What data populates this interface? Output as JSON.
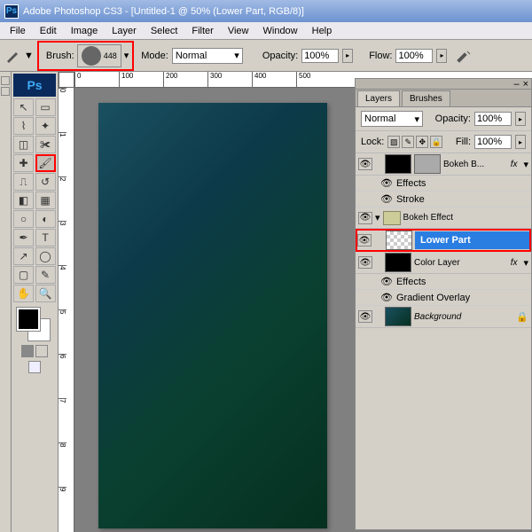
{
  "title": "Adobe Photoshop CS3 - [Untitled-1 @ 50% (Lower Part, RGB/8)]",
  "menu": [
    "File",
    "Edit",
    "Image",
    "Layer",
    "Select",
    "Filter",
    "View",
    "Window",
    "Help"
  ],
  "options": {
    "brush_label": "Brush:",
    "brush_size": "448",
    "mode_label": "Mode:",
    "mode_value": "Normal",
    "opacity_label": "Opacity:",
    "opacity_value": "100%",
    "flow_label": "Flow:",
    "flow_value": "100%"
  },
  "layers_panel": {
    "tabs": [
      "Layers",
      "Brushes"
    ],
    "blend_mode": "Normal",
    "opacity_label": "Opacity:",
    "opacity": "100%",
    "lock_label": "Lock:",
    "fill_label": "Fill:",
    "fill": "100%",
    "layers": [
      {
        "name": "Bokeh B...",
        "fx": true,
        "effects": [
          "Effects",
          "Stroke"
        ]
      },
      {
        "name": "Bokeh Effect",
        "type": "group"
      },
      {
        "name": "Lower Part",
        "selected": true,
        "highlight": true,
        "trans": true
      },
      {
        "name": "Color Layer",
        "fx": true,
        "effects": [
          "Effects",
          "Gradient Overlay"
        ]
      },
      {
        "name": "Background",
        "italic": true,
        "locked": true
      }
    ]
  },
  "ruler_h": [
    "0",
    "100",
    "200",
    "300",
    "400",
    "500"
  ],
  "ruler_v": [
    "0",
    "1",
    "2",
    "3",
    "4",
    "5",
    "6",
    "7",
    "8",
    "9"
  ]
}
